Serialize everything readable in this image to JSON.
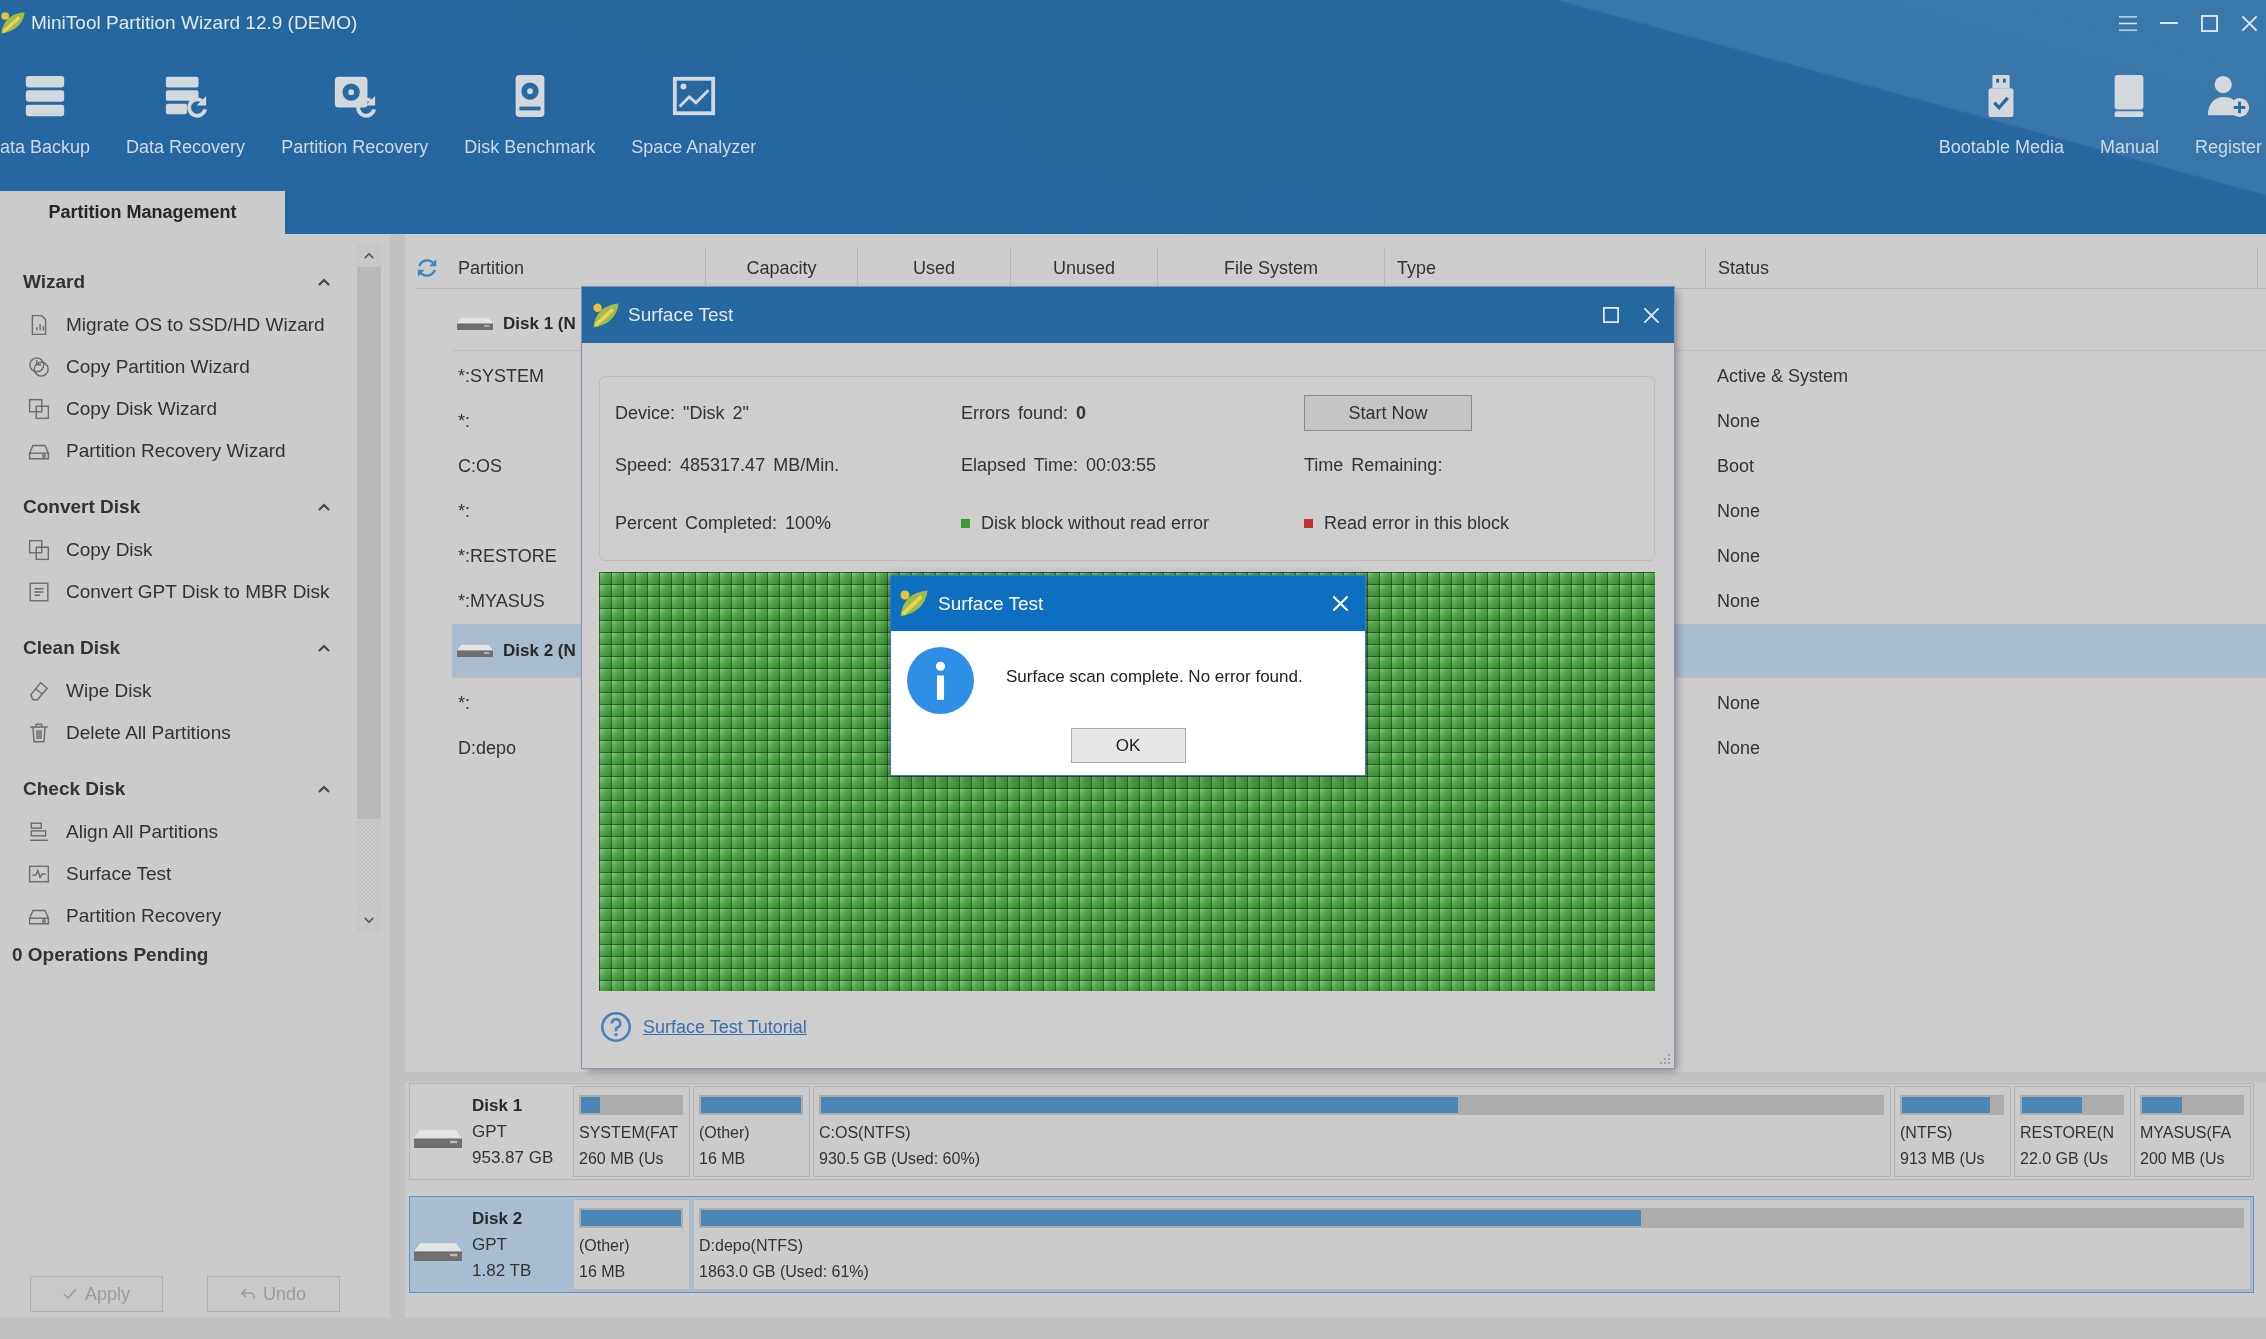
{
  "window": {
    "title": "MiniTool Partition Wizard 12.9 (DEMO)"
  },
  "toolbar": {
    "left": [
      "ata Backup",
      "Data Recovery",
      "Partition Recovery",
      "Disk Benchmark",
      "Space Analyzer"
    ],
    "right": [
      "Bootable Media",
      "Manual",
      "Register"
    ]
  },
  "tabs": [
    {
      "label": "Partition Management",
      "selected": true
    }
  ],
  "sidebar": {
    "sections": [
      {
        "title": "Wizard",
        "expanded": true,
        "items": [
          "Migrate OS to SSD/HD Wizard",
          "Copy Partition Wizard",
          "Copy Disk Wizard",
          "Partition Recovery Wizard"
        ]
      },
      {
        "title": "Convert Disk",
        "expanded": true,
        "items": [
          "Copy Disk",
          "Convert GPT Disk to MBR Disk"
        ]
      },
      {
        "title": "Clean Disk",
        "expanded": true,
        "items": [
          "Wipe Disk",
          "Delete All Partitions"
        ]
      },
      {
        "title": "Check Disk",
        "expanded": true,
        "items": [
          "Align All Partitions",
          "Surface Test",
          "Partition Recovery"
        ]
      }
    ],
    "pending": "0 Operations Pending",
    "buttons": [
      {
        "label": "Apply",
        "disabled": true
      },
      {
        "label": "Undo",
        "disabled": true
      }
    ]
  },
  "table": {
    "columns": [
      "Partition",
      "Capacity",
      "Used",
      "Unused",
      "File System",
      "Type",
      "Status"
    ],
    "rows": [
      {
        "kind": "disk",
        "partition": "Disk 1 (N",
        "selected": false
      },
      {
        "kind": "partition",
        "partition": "*:SYSTEM",
        "status": "Active & System",
        "selected": false
      },
      {
        "kind": "partition",
        "partition": "*:",
        "status": "None",
        "selected": false
      },
      {
        "kind": "partition",
        "partition": "C:OS",
        "status": "Boot",
        "selected": false
      },
      {
        "kind": "partition",
        "partition": "*:",
        "status": "None",
        "selected": false
      },
      {
        "kind": "partition",
        "partition": "*:RESTORE",
        "status": "None",
        "selected": false
      },
      {
        "kind": "partition",
        "partition": "*:MYASUS",
        "status": "None",
        "selected": false
      },
      {
        "kind": "disk",
        "partition": "Disk 2 (N",
        "selected": true
      },
      {
        "kind": "partition",
        "partition": "*:",
        "status": "None",
        "selected": false
      },
      {
        "kind": "partition",
        "partition": "D:depo",
        "status": "None",
        "selected": false
      }
    ]
  },
  "disk_map": [
    {
      "name": "Disk 1",
      "scheme": "GPT",
      "size": "953.87 GB",
      "selected": false,
      "partitions": [
        {
          "kind": "narrow",
          "label": "SYSTEM(FAT",
          "detail": "260 MB (Us",
          "level": 0.19
        },
        {
          "kind": "narrow",
          "label": "(Other)",
          "detail": "16 MB",
          "level": 1
        },
        {
          "kind": "wide",
          "label": "C:OS(NTFS)",
          "detail": "930.5 GB (Used: 60%)",
          "level": 0.6
        },
        {
          "kind": "narrow",
          "label": "(NTFS)",
          "detail": "913 MB (Us",
          "level": 0.88
        },
        {
          "kind": "narrow",
          "label": "RESTORE(N",
          "detail": "22.0 GB (Us",
          "level": 0.6
        },
        {
          "kind": "narrow",
          "label": "MYASUS(FA",
          "detail": "200 MB (Us",
          "level": 0.4
        }
      ]
    },
    {
      "name": "Disk 2",
      "scheme": "GPT",
      "size": "1.82 TB",
      "selected": true,
      "partitions": [
        {
          "kind": "narrow",
          "label": "(Other)",
          "detail": "16 MB",
          "level": 1
        },
        {
          "kind": "wide",
          "label": "D:depo(NTFS)",
          "detail": "1863.0 GB (Used: 61%)",
          "level": 0.61
        }
      ]
    }
  ],
  "surface_test_dialog": {
    "title": "Surface Test",
    "stats": [
      "Device: \"Disk 2\"",
      "Errors found: **0**",
      "Speed: 485317.47 MB/Min.",
      "Elapsed Time: 00:03:55",
      "Time Remaining:",
      "Percent Completed: 100%"
    ],
    "start_button": "Start Now",
    "legend": [
      {
        "label": "Disk block without read error",
        "color": "#3c9c33"
      },
      {
        "label": "Read error in this block",
        "color": "#c0302c"
      }
    ],
    "tutorial_link": "Surface Test Tutorial"
  },
  "message_box": {
    "title": "Surface Test",
    "message": "Surface scan complete. No error found.",
    "button": "OK"
  }
}
